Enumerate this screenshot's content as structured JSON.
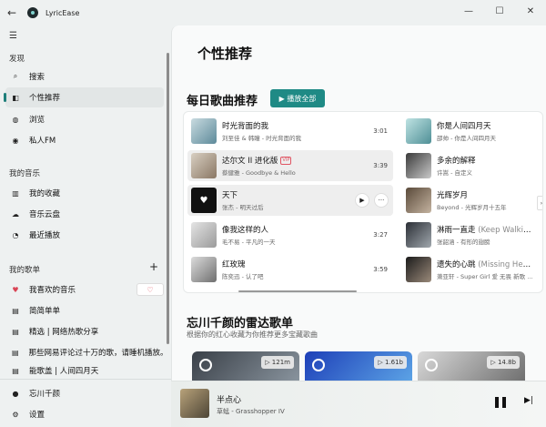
{
  "window": {
    "title": "LyricEase",
    "back": "←",
    "minimize": "—",
    "maximize": "☐",
    "close": "✕"
  },
  "sidebar": {
    "discover_label": "发现",
    "discover_items": [
      {
        "label": "搜索",
        "icon": "search-icon",
        "glyph": "⌕"
      },
      {
        "label": "个性推荐",
        "icon": "bookmark-icon",
        "glyph": "◧"
      },
      {
        "label": "浏览",
        "icon": "globe-icon",
        "glyph": "◍"
      },
      {
        "label": "私人FM",
        "icon": "radio-icon",
        "glyph": "◉"
      }
    ],
    "music_label": "我的音乐",
    "music_items": [
      {
        "label": "我的收藏",
        "icon": "library-icon",
        "glyph": "▥"
      },
      {
        "label": "音乐云盘",
        "icon": "cloud-icon",
        "glyph": "☁"
      },
      {
        "label": "最近播放",
        "icon": "clock-icon",
        "glyph": "◔"
      }
    ],
    "playlists_label": "我的歌单",
    "playlist_items": [
      {
        "label": "我喜欢的音乐",
        "icon": "heart-icon",
        "glyph": "♥"
      },
      {
        "label": "简简单单",
        "icon": "playlist-icon",
        "glyph": "▤"
      },
      {
        "label": "精选 | 网络热歌分享",
        "icon": "playlist-icon",
        "glyph": "▤"
      },
      {
        "label": "那些网易评论过十万的歌，请睡机播放。",
        "icon": "playlist-icon",
        "glyph": "▤"
      },
      {
        "label": "能歌盖 | 人间四月天",
        "icon": "playlist-icon",
        "glyph": "▤"
      }
    ],
    "user_name": "忘川千颜",
    "settings_label": "设置"
  },
  "main": {
    "page_title": "个性推荐",
    "daily_title": "每日歌曲推荐",
    "play_all": "▶ 播放全部",
    "songs_left": [
      {
        "title": "时光背面的我",
        "alt": "",
        "sub": "刘至佳 & 韩瞳 - 时光背面的我",
        "duration": "3:01",
        "vip": ""
      },
      {
        "title": "达尔文 II 进化版",
        "alt": "",
        "sub": "蔡健雅 - Goodbye & Hello",
        "duration": "3:39",
        "vip": "VIP"
      },
      {
        "title": "天下",
        "alt": "",
        "sub": "张杰 - 明天过后",
        "duration": "",
        "vip": ""
      },
      {
        "title": "像我这样的人",
        "alt": "",
        "sub": "毛不易 - 平凡的一天",
        "duration": "3:27",
        "vip": ""
      },
      {
        "title": "红玫瑰",
        "alt": "",
        "sub": "陈奕迅 - 认了吧",
        "duration": "3:59",
        "vip": ""
      }
    ],
    "songs_right": [
      {
        "title": "你是人间四月天",
        "alt": "",
        "sub": "邵帅 - 你是人间四月天"
      },
      {
        "title": "多余的解释",
        "alt": "",
        "sub": "许嵩 - 自定义"
      },
      {
        "title": "光辉岁月",
        "alt": "",
        "sub": "Beyond - 光辉岁月十五年"
      },
      {
        "title": "淋雨一直走",
        "alt": " (Keep Walking)",
        "sub": "张韶涵 - 有形的翅膀"
      },
      {
        "title": "遗失的心跳",
        "alt": " (Missing Heartbeat)",
        "sub": "萧亚轩 - Super Girl 爱 无畏 新歌 + 精选"
      }
    ],
    "radar_title": "忘川千颜的雷达歌单",
    "radar_sub": "根据你的红心收藏为你推荐更多宝藏歌曲",
    "radar_cards": [
      {
        "count": "▷ 121m"
      },
      {
        "count": "▷ 1.61b"
      },
      {
        "count": "▷ 14.8b"
      }
    ]
  },
  "player": {
    "title": "半点心",
    "artist": "草蜢 - Grasshopper IV"
  }
}
